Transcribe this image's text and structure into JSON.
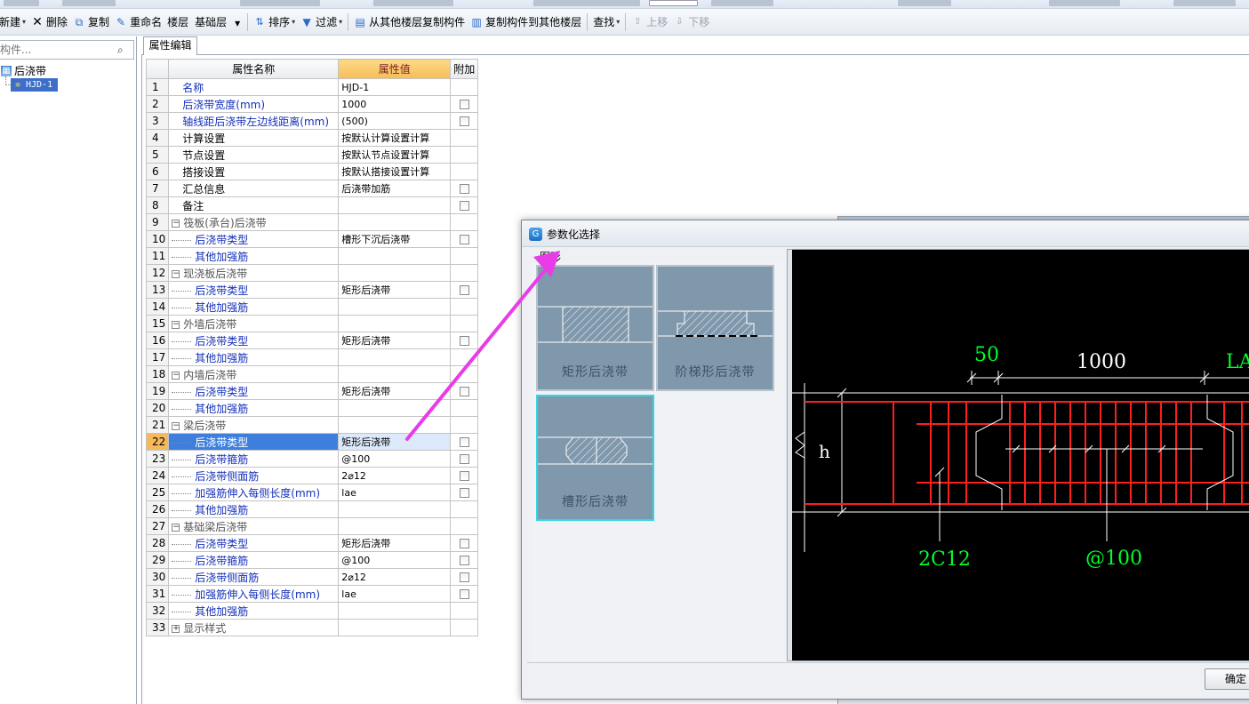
{
  "toolbar": {
    "new_label": "新建",
    "delete_label": "删除",
    "copy_label": "复制",
    "rename_label": "重命名",
    "floor_label": "楼层",
    "floor_value": "基础层",
    "sort_label": "排序",
    "filter_label": "过滤",
    "copy_from_floor_label": "从其他楼层复制构件",
    "copy_to_floor_label": "复制构件到其他楼层",
    "find_label": "查找",
    "move_up_label": "上移",
    "move_down_label": "下移"
  },
  "left_pane": {
    "search_placeholder": "构件...",
    "tree": {
      "root_label": "后浇带",
      "child_label": "HJD-1"
    }
  },
  "property_editor": {
    "tab_label": "属性编辑",
    "columns": {
      "name": "属性名称",
      "value": "属性值",
      "extra": "附加"
    },
    "rows": [
      {
        "num": "1",
        "name": "名称",
        "value": "HJD-1",
        "checkbox": false
      },
      {
        "num": "2",
        "name": "后浇带宽度(mm)",
        "value": "1000",
        "checkbox": true
      },
      {
        "num": "3",
        "name": "轴线距后浇带左边线距离(mm)",
        "value": "(500)",
        "checkbox": true
      },
      {
        "num": "4",
        "name": "计算设置",
        "value": "按默认计算设置计算",
        "checkbox": false
      },
      {
        "num": "5",
        "name": "节点设置",
        "value": "按默认节点设置计算",
        "checkbox": false
      },
      {
        "num": "6",
        "name": "搭接设置",
        "value": "按默认搭接设置计算",
        "checkbox": false
      },
      {
        "num": "7",
        "name": "汇总信息",
        "value": "后浇带加筋",
        "checkbox": true
      },
      {
        "num": "8",
        "name": "备注",
        "value": "",
        "checkbox": true
      },
      {
        "num": "9",
        "name": "筏板(承台)后浇带",
        "value": "",
        "checkbox": false
      },
      {
        "num": "10",
        "name": "后浇带类型",
        "value": "槽形下沉后浇带",
        "checkbox": true
      },
      {
        "num": "11",
        "name": "其他加强筋",
        "value": "",
        "checkbox": false
      },
      {
        "num": "12",
        "name": "现浇板后浇带",
        "value": "",
        "checkbox": false
      },
      {
        "num": "13",
        "name": "后浇带类型",
        "value": "矩形后浇带",
        "checkbox": true
      },
      {
        "num": "14",
        "name": "其他加强筋",
        "value": "",
        "checkbox": false
      },
      {
        "num": "15",
        "name": "外墙后浇带",
        "value": "",
        "checkbox": false
      },
      {
        "num": "16",
        "name": "后浇带类型",
        "value": "矩形后浇带",
        "checkbox": true
      },
      {
        "num": "17",
        "name": "其他加强筋",
        "value": "",
        "checkbox": false
      },
      {
        "num": "18",
        "name": "内墙后浇带",
        "value": "",
        "checkbox": false
      },
      {
        "num": "19",
        "name": "后浇带类型",
        "value": "矩形后浇带",
        "checkbox": true
      },
      {
        "num": "20",
        "name": "其他加强筋",
        "value": "",
        "checkbox": false
      },
      {
        "num": "21",
        "name": "梁后浇带",
        "value": "",
        "checkbox": false
      },
      {
        "num": "22",
        "name": "后浇带类型",
        "value": "矩形后浇带",
        "checkbox": true
      },
      {
        "num": "23",
        "name": "后浇带箍筋",
        "value": "@100",
        "checkbox": true
      },
      {
        "num": "24",
        "name": "后浇带侧面筋",
        "value": "2⌀12",
        "checkbox": true
      },
      {
        "num": "25",
        "name": "加强筋伸入每侧长度(mm)",
        "value": "lae",
        "checkbox": true
      },
      {
        "num": "26",
        "name": "其他加强筋",
        "value": "",
        "checkbox": false
      },
      {
        "num": "27",
        "name": "基础梁后浇带",
        "value": "",
        "checkbox": false
      },
      {
        "num": "28",
        "name": "后浇带类型",
        "value": "矩形后浇带",
        "checkbox": true
      },
      {
        "num": "29",
        "name": "后浇带箍筋",
        "value": "@100",
        "checkbox": true
      },
      {
        "num": "30",
        "name": "后浇带侧面筋",
        "value": "2⌀12",
        "checkbox": true
      },
      {
        "num": "31",
        "name": "加强筋伸入每侧长度(mm)",
        "value": "lae",
        "checkbox": true
      },
      {
        "num": "32",
        "name": "其他加强筋",
        "value": "",
        "checkbox": false
      },
      {
        "num": "33",
        "name": "显示样式",
        "value": "",
        "checkbox": false
      }
    ]
  },
  "dialog": {
    "title": "参数化选择",
    "section_label": "图形",
    "options": [
      {
        "label": "矩形后浇带",
        "selected": false
      },
      {
        "label": "阶梯形后浇带",
        "selected": false
      },
      {
        "label": "槽形后浇带",
        "selected": true
      }
    ],
    "preview": {
      "dim_50": "50",
      "dim_1000": "1000",
      "dim_lae": "LAE",
      "h_label": "h",
      "side_bar_label": "2C12",
      "stirrup_label": "@100"
    },
    "ok_label": "确定"
  },
  "colors": {
    "selected_row": "#3e7fde",
    "value_header": "#f6bd55",
    "annotation_arrow": "#e83ce8",
    "cad_green": "#00ff2a",
    "cad_red": "#ff1e1e",
    "thumb_selected_border": "#34d6e6"
  }
}
